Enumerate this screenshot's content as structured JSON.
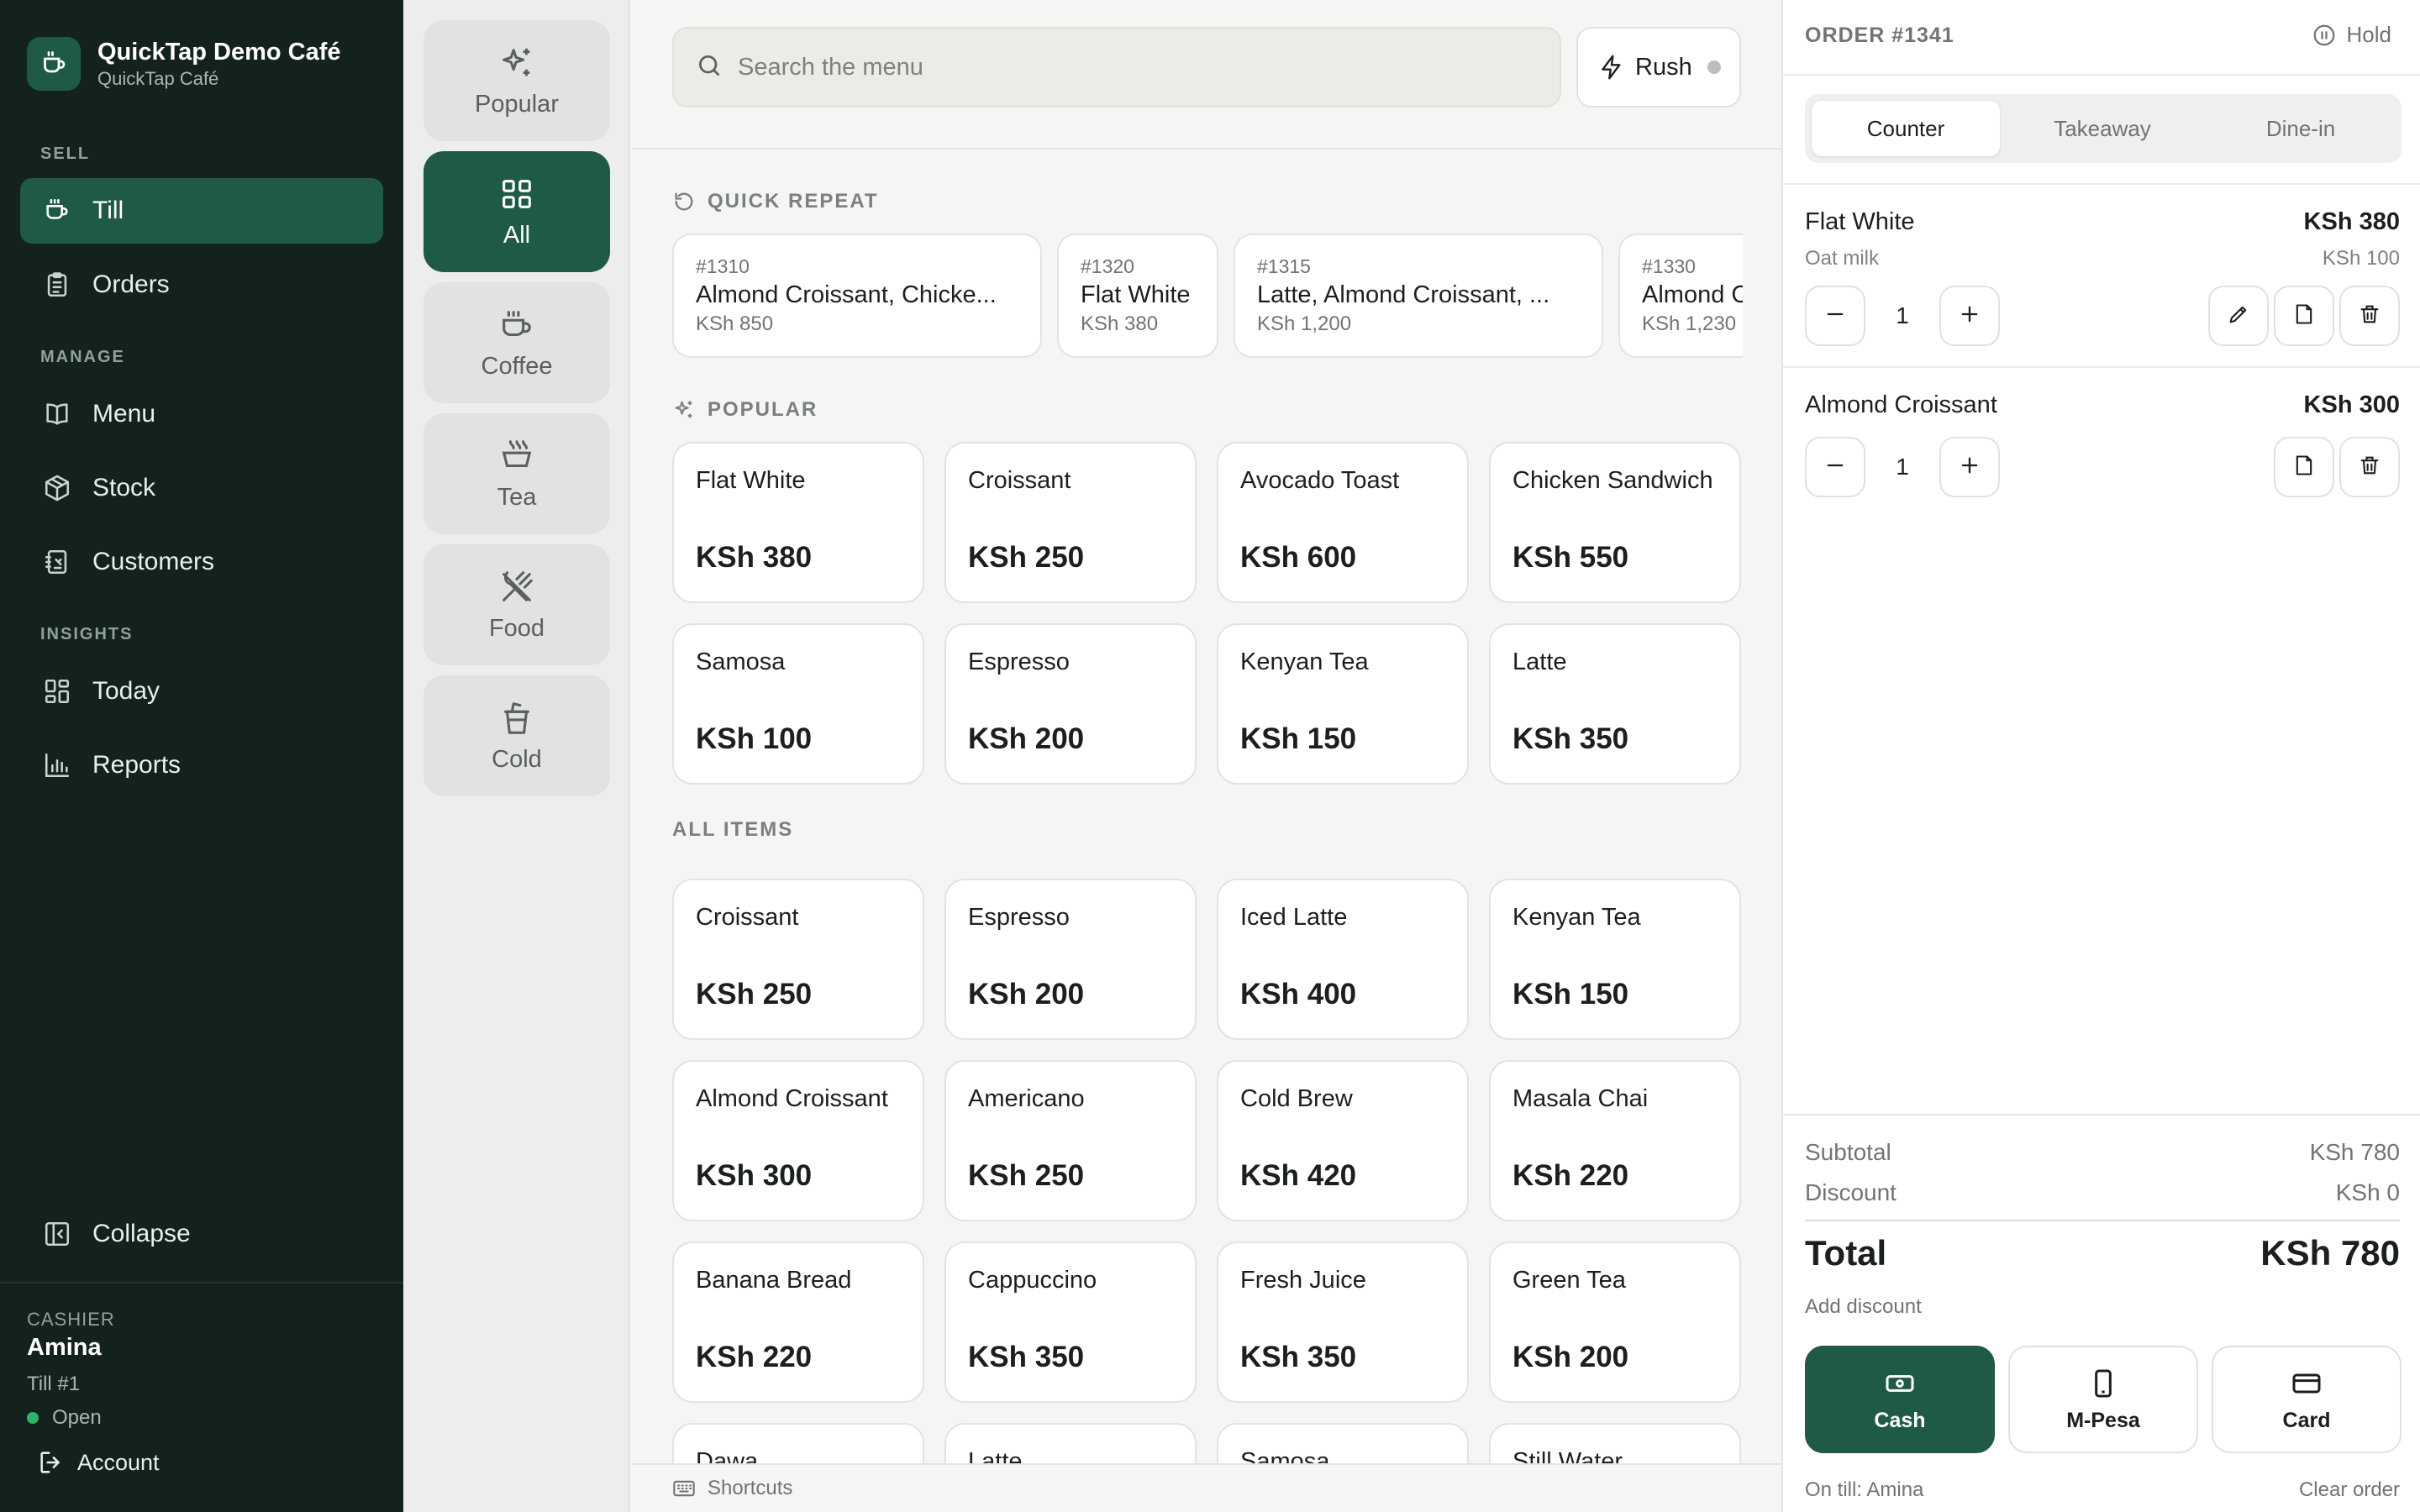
{
  "brand": {
    "name": "QuickTap Demo Café",
    "subtitle": "QuickTap Café"
  },
  "sidebar": {
    "sections": [
      "SELL",
      "MANAGE",
      "INSIGHTS"
    ],
    "items": [
      {
        "label": "Till",
        "icon": "cup-icon",
        "active": true
      },
      {
        "label": "Orders",
        "icon": "clipboard-icon"
      },
      {
        "label": "Menu",
        "icon": "book-icon"
      },
      {
        "label": "Stock",
        "icon": "box-icon"
      },
      {
        "label": "Customers",
        "icon": "contacts-icon"
      },
      {
        "label": "Today",
        "icon": "dashboard-icon"
      },
      {
        "label": "Reports",
        "icon": "bar-chart-icon"
      }
    ],
    "collapse_label": "Collapse",
    "cashier": {
      "label": "CASHIER",
      "name": "Amina",
      "till": "Till #1",
      "status": "Open",
      "account_label": "Account"
    }
  },
  "categories": [
    {
      "label": "Popular",
      "icon": "sparkles-icon"
    },
    {
      "label": "All",
      "icon": "grid-icon",
      "active": true
    },
    {
      "label": "Coffee",
      "icon": "coffee-icon"
    },
    {
      "label": "Tea",
      "icon": "tea-icon"
    },
    {
      "label": "Food",
      "icon": "utensils-icon"
    },
    {
      "label": "Cold",
      "icon": "cold-cup-icon"
    }
  ],
  "search": {
    "placeholder": "Search the menu"
  },
  "rush": {
    "label": "Rush"
  },
  "quick_repeat": {
    "title": "QUICK REPEAT",
    "orders": [
      {
        "id": "#1310",
        "items": "Almond Croissant, Chicke...",
        "price": "KSh 850"
      },
      {
        "id": "#1320",
        "items": "Flat White",
        "price": "KSh 380"
      },
      {
        "id": "#1315",
        "items": "Latte, Almond Croissant, ...",
        "price": "KSh 1,200"
      },
      {
        "id": "#1330",
        "items": "Almond Croissant",
        "price": "KSh 1,230"
      }
    ]
  },
  "popular": {
    "title": "POPULAR",
    "items": [
      {
        "name": "Flat White",
        "price": "KSh 380"
      },
      {
        "name": "Croissant",
        "price": "KSh 250"
      },
      {
        "name": "Avocado Toast",
        "price": "KSh 600"
      },
      {
        "name": "Chicken Sandwich",
        "price": "KSh 550"
      },
      {
        "name": "Samosa",
        "price": "KSh 100"
      },
      {
        "name": "Espresso",
        "price": "KSh 200"
      },
      {
        "name": "Kenyan Tea",
        "price": "KSh 150"
      },
      {
        "name": "Latte",
        "price": "KSh 350"
      }
    ]
  },
  "all_items": {
    "title": "ALL ITEMS",
    "items": [
      {
        "name": "Croissant",
        "price": "KSh 250"
      },
      {
        "name": "Espresso",
        "price": "KSh 200"
      },
      {
        "name": "Iced Latte",
        "price": "KSh 400"
      },
      {
        "name": "Kenyan Tea",
        "price": "KSh 150"
      },
      {
        "name": "Almond Croissant",
        "price": "KSh 300"
      },
      {
        "name": "Americano",
        "price": "KSh 250"
      },
      {
        "name": "Cold Brew",
        "price": "KSh 420"
      },
      {
        "name": "Masala Chai",
        "price": "KSh 220"
      },
      {
        "name": "Banana Bread",
        "price": "KSh 220"
      },
      {
        "name": "Cappuccino",
        "price": "KSh 350"
      },
      {
        "name": "Fresh Juice",
        "price": "KSh 350"
      },
      {
        "name": "Green Tea",
        "price": "KSh 200"
      },
      {
        "name": "Dawa",
        "price": ""
      },
      {
        "name": "Latte",
        "price": ""
      },
      {
        "name": "Samosa",
        "price": ""
      },
      {
        "name": "Still Water",
        "price": ""
      }
    ]
  },
  "shortcuts_label": "Shortcuts",
  "order": {
    "number": "ORDER #1341",
    "hold_label": "Hold",
    "types": [
      "Counter",
      "Takeaway",
      "Dine-in"
    ],
    "active_type": "Counter",
    "lines": [
      {
        "name": "Flat White",
        "price": "KSh 380",
        "modifier": "Oat milk",
        "modifier_price": "KSh 100",
        "qty": "1"
      },
      {
        "name": "Almond Croissant",
        "price": "KSh 300",
        "qty": "1"
      }
    ],
    "subtotal_label": "Subtotal",
    "subtotal": "KSh 780",
    "discount_label": "Discount",
    "discount": "KSh 0",
    "total_label": "Total",
    "total": "KSh 780",
    "add_discount_label": "Add discount",
    "payments": [
      "Cash",
      "M-Pesa",
      "Card"
    ],
    "on_till": "On till: Amina",
    "clear_label": "Clear order"
  },
  "colors": {
    "accent": "#1f5a45",
    "sidebar_bg": "#14221d",
    "status_open": "#2fb36b"
  }
}
